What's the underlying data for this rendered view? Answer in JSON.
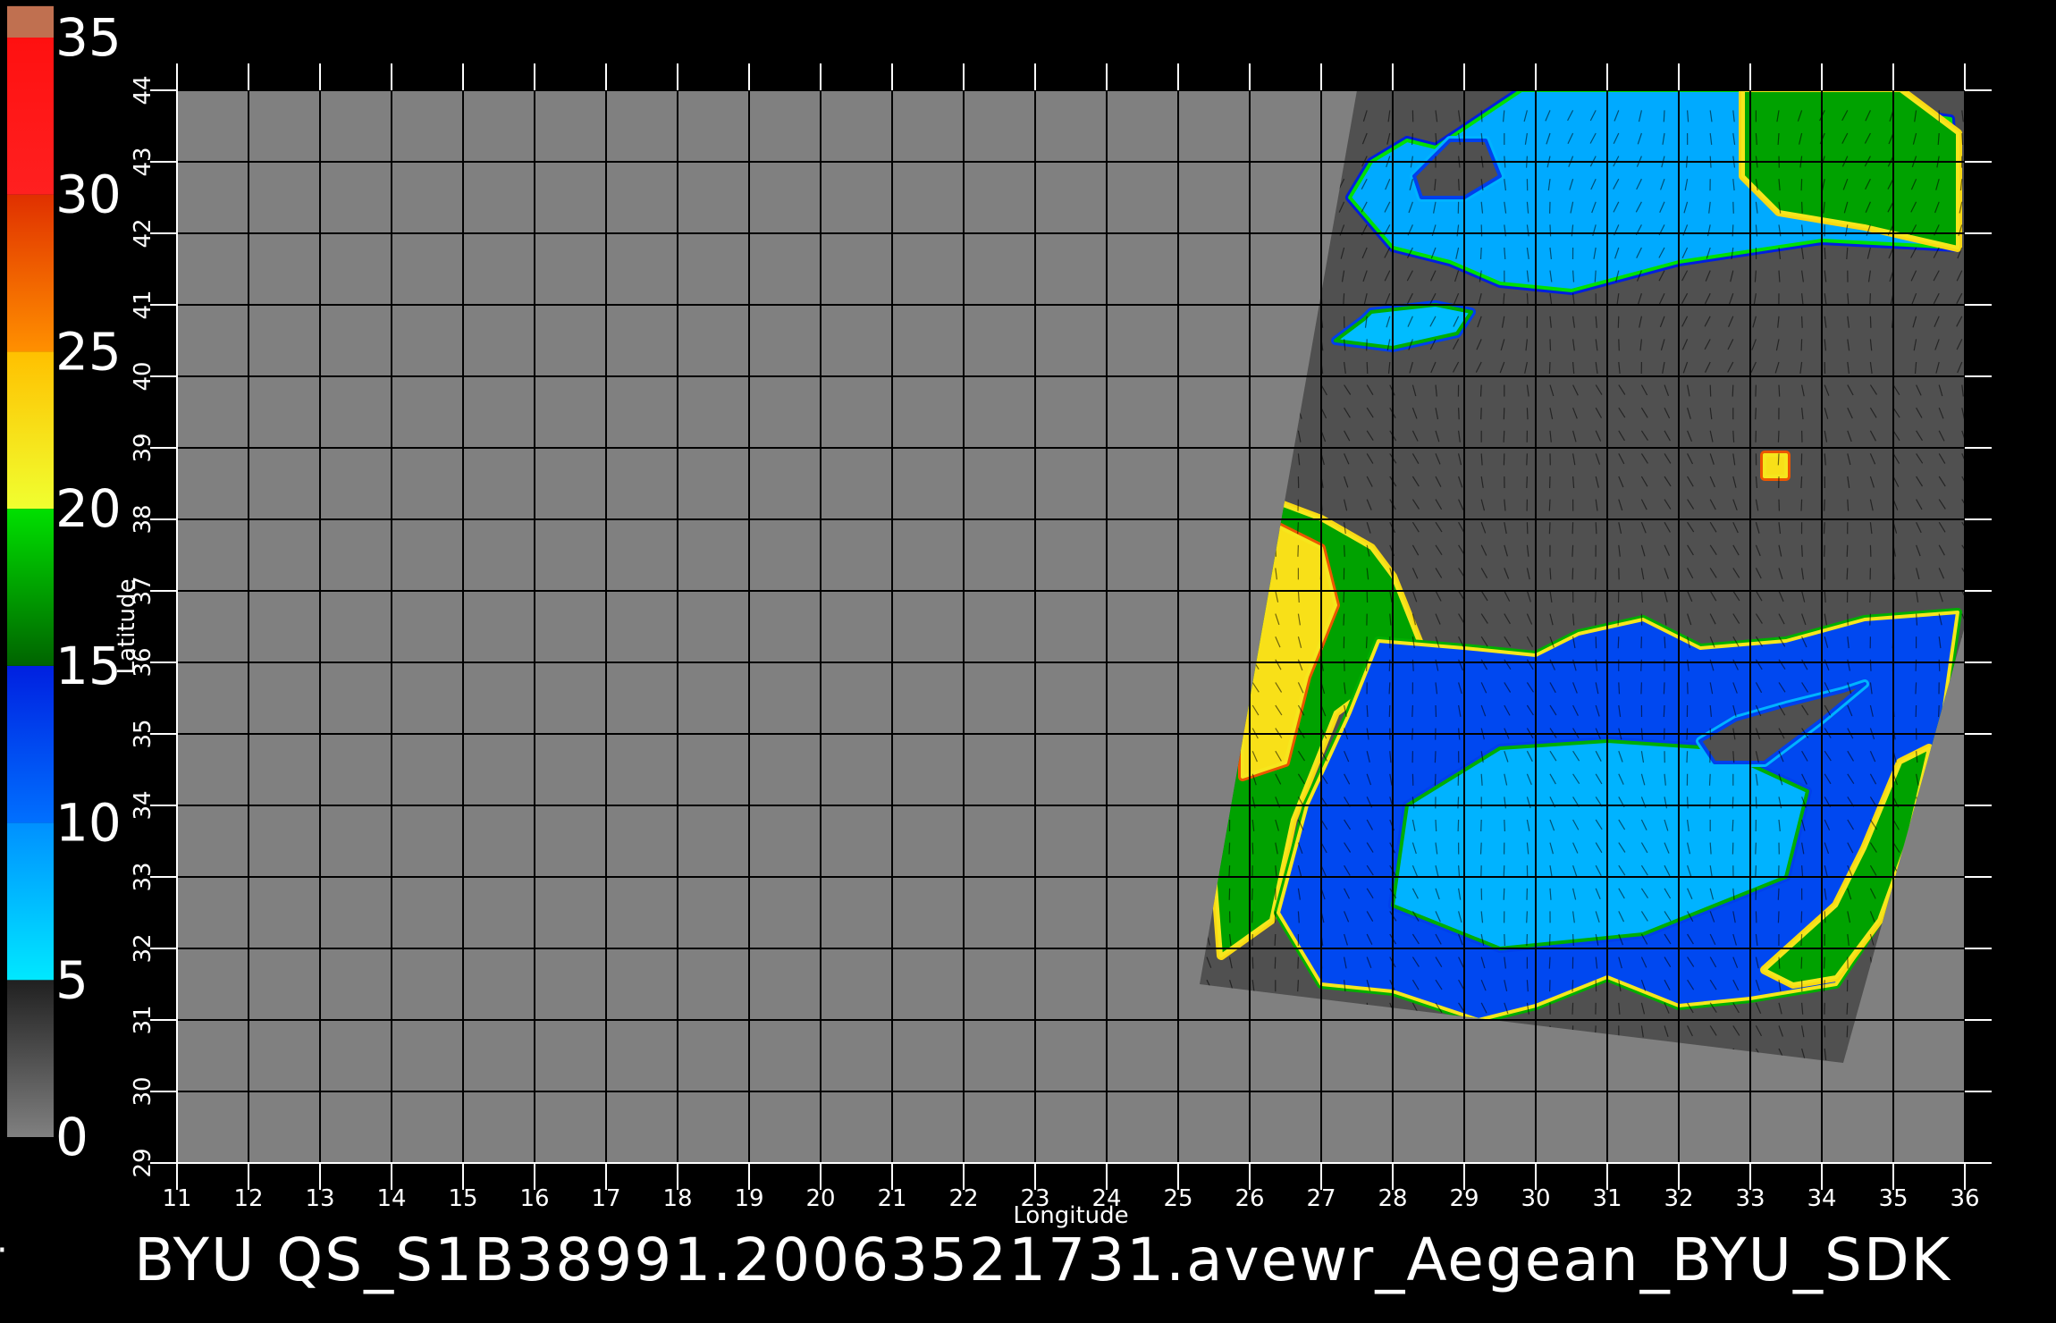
{
  "figure": {
    "title": "BYU  QS_S1B38991.20063521731.avewr_Aegean_BYU_SDK",
    "xlabel": "Longitude",
    "ylabel": "Latitude",
    "colorbar": {
      "labels": [
        "0",
        "5",
        "10",
        "15",
        "20",
        "25",
        "30",
        "35"
      ],
      "range": [
        0,
        35
      ],
      "segments": [
        {
          "from": 0,
          "to": 5,
          "colors": [
            "#808080",
            "#202020"
          ]
        },
        {
          "from": 5,
          "to": 10,
          "colors": [
            "#00e8ff",
            "#0090ff"
          ]
        },
        {
          "from": 10,
          "to": 15,
          "colors": [
            "#0070ff",
            "#0020e0"
          ]
        },
        {
          "from": 15,
          "to": 20,
          "colors": [
            "#006400",
            "#00e000"
          ]
        },
        {
          "from": 20,
          "to": 25,
          "colors": [
            "#f0ff30",
            "#ffc000"
          ]
        },
        {
          "from": 25,
          "to": 30,
          "colors": [
            "#ff9000",
            "#e03000"
          ]
        },
        {
          "from": 30,
          "to": 35,
          "colors": [
            "#ff2020",
            "#ff1010"
          ]
        },
        {
          "from": 35,
          "to": 36,
          "colors": [
            "#c07050",
            "#c07050"
          ]
        }
      ]
    },
    "colors": {
      "background": "#000000",
      "map_gray": "#808080",
      "swath_dark": "#505050",
      "grid": "#000000"
    }
  },
  "chart_data": {
    "type": "heatmap",
    "title": "BYU  QS_S1B38991.20063521731.avewr_Aegean_BYU_SDK",
    "xlabel": "Longitude",
    "ylabel": "Latitude",
    "xlim": [
      11,
      36
    ],
    "ylim": [
      29,
      44
    ],
    "x_ticks": [
      11,
      12,
      13,
      14,
      15,
      16,
      17,
      18,
      19,
      20,
      21,
      22,
      23,
      24,
      25,
      26,
      27,
      28,
      29,
      30,
      31,
      32,
      33,
      34,
      35,
      36
    ],
    "y_ticks": [
      29,
      30,
      31,
      32,
      33,
      34,
      35,
      36,
      37,
      38,
      39,
      40,
      41,
      42,
      43,
      44
    ],
    "colorbar_ticks": [
      0,
      5,
      10,
      15,
      20,
      25,
      30,
      35
    ],
    "grid": true,
    "swath_corners_lonlat": [
      [
        27.5,
        44.0
      ],
      [
        36.0,
        44.0
      ],
      [
        36.0,
        36.5
      ],
      [
        34.3,
        30.4
      ],
      [
        25.3,
        31.5
      ]
    ],
    "regions": [
      {
        "name": "black-sea",
        "range": [
          5,
          12
        ],
        "polygon": [
          [
            28.6,
            43.2
          ],
          [
            29.8,
            44.0
          ],
          [
            33.0,
            44.0
          ],
          [
            35.8,
            43.6
          ],
          [
            35.9,
            41.8
          ],
          [
            34.0,
            41.9
          ],
          [
            32.0,
            41.6
          ],
          [
            30.5,
            41.2
          ],
          [
            29.5,
            41.3
          ],
          [
            28.8,
            41.6
          ],
          [
            28.0,
            41.8
          ],
          [
            27.4,
            42.5
          ],
          [
            27.7,
            43.0
          ],
          [
            28.2,
            43.3
          ]
        ]
      },
      {
        "name": "black-sea-east-green",
        "range": [
          15,
          20
        ],
        "polygon": [
          [
            32.9,
            44.0
          ],
          [
            35.1,
            44.0
          ],
          [
            35.9,
            43.4
          ],
          [
            35.9,
            41.8
          ],
          [
            34.6,
            42.1
          ],
          [
            33.4,
            42.3
          ],
          [
            32.9,
            42.8
          ]
        ]
      },
      {
        "name": "black-sea-dark-patch",
        "range": [
          0,
          5
        ],
        "polygon": [
          [
            28.3,
            42.8
          ],
          [
            28.8,
            43.3
          ],
          [
            29.3,
            43.3
          ],
          [
            29.5,
            42.8
          ],
          [
            29.0,
            42.5
          ],
          [
            28.4,
            42.5
          ]
        ]
      },
      {
        "name": "marmara-sea",
        "range": [
          5,
          10
        ],
        "polygon": [
          [
            27.7,
            40.9
          ],
          [
            28.6,
            41.0
          ],
          [
            29.1,
            40.9
          ],
          [
            28.9,
            40.6
          ],
          [
            28.0,
            40.4
          ],
          [
            27.2,
            40.5
          ],
          [
            27.6,
            40.8
          ]
        ]
      },
      {
        "name": "aegean-green",
        "range": [
          15,
          20
        ],
        "polygon": [
          [
            26.2,
            38.3
          ],
          [
            27.0,
            38.0
          ],
          [
            27.7,
            37.6
          ],
          [
            28.0,
            37.2
          ],
          [
            28.4,
            36.2
          ],
          [
            27.2,
            35.3
          ],
          [
            26.6,
            33.8
          ],
          [
            26.3,
            32.4
          ],
          [
            25.6,
            31.9
          ],
          [
            25.5,
            33.2
          ],
          [
            25.7,
            34.5
          ],
          [
            25.9,
            36.0
          ]
        ]
      },
      {
        "name": "aegean-yellow",
        "range": [
          20,
          25
        ],
        "polygon": [
          [
            26.2,
            38.0
          ],
          [
            27.0,
            37.6
          ],
          [
            27.2,
            36.8
          ],
          [
            26.8,
            35.8
          ],
          [
            26.5,
            34.6
          ],
          [
            25.9,
            34.4
          ],
          [
            25.9,
            36.0
          ]
        ]
      },
      {
        "name": "eastern-med",
        "range": [
          10,
          15
        ],
        "polygon": [
          [
            27.8,
            36.3
          ],
          [
            29.0,
            36.2
          ],
          [
            30.0,
            36.1
          ],
          [
            30.6,
            36.4
          ],
          [
            31.5,
            36.6
          ],
          [
            32.3,
            36.2
          ],
          [
            33.5,
            36.3
          ],
          [
            34.6,
            36.6
          ],
          [
            35.9,
            36.7
          ],
          [
            35.7,
            35.3
          ],
          [
            35.2,
            33.5
          ],
          [
            34.8,
            32.4
          ],
          [
            34.2,
            31.5
          ],
          [
            33.0,
            31.3
          ],
          [
            32.0,
            31.2
          ],
          [
            31.0,
            31.6
          ],
          [
            30.0,
            31.2
          ],
          [
            29.2,
            31.0
          ],
          [
            28.0,
            31.4
          ],
          [
            27.0,
            31.5
          ],
          [
            26.4,
            32.5
          ],
          [
            26.8,
            34.0
          ],
          [
            27.4,
            35.3
          ]
        ]
      },
      {
        "name": "eastern-med-light",
        "range": [
          6,
          10
        ],
        "polygon": [
          [
            28.2,
            34.0
          ],
          [
            29.5,
            34.8
          ],
          [
            31.0,
            34.9
          ],
          [
            32.5,
            34.8
          ],
          [
            33.8,
            34.2
          ],
          [
            33.5,
            33.0
          ],
          [
            31.5,
            32.2
          ],
          [
            29.5,
            32.0
          ],
          [
            28.0,
            32.6
          ]
        ]
      },
      {
        "name": "levant-coast-green",
        "range": [
          15,
          20
        ],
        "polygon": [
          [
            34.8,
            32.4
          ],
          [
            35.2,
            33.5
          ],
          [
            35.5,
            34.8
          ],
          [
            35.1,
            34.6
          ],
          [
            34.6,
            33.4
          ],
          [
            34.2,
            32.6
          ],
          [
            33.2,
            31.7
          ],
          [
            33.6,
            31.5
          ],
          [
            34.2,
            31.6
          ]
        ]
      },
      {
        "name": "cyprus",
        "range": [
          0,
          5
        ],
        "polygon": [
          [
            32.3,
            34.9
          ],
          [
            32.8,
            35.2
          ],
          [
            33.5,
            35.4
          ],
          [
            34.3,
            35.6
          ],
          [
            34.6,
            35.7
          ],
          [
            34.0,
            35.2
          ],
          [
            33.2,
            34.6
          ],
          [
            32.5,
            34.6
          ]
        ]
      },
      {
        "name": "tuz-lake",
        "range": [
          20,
          25
        ],
        "polygon": [
          [
            33.2,
            38.9
          ],
          [
            33.5,
            38.9
          ],
          [
            33.5,
            38.6
          ],
          [
            33.2,
            38.6
          ]
        ]
      }
    ]
  }
}
